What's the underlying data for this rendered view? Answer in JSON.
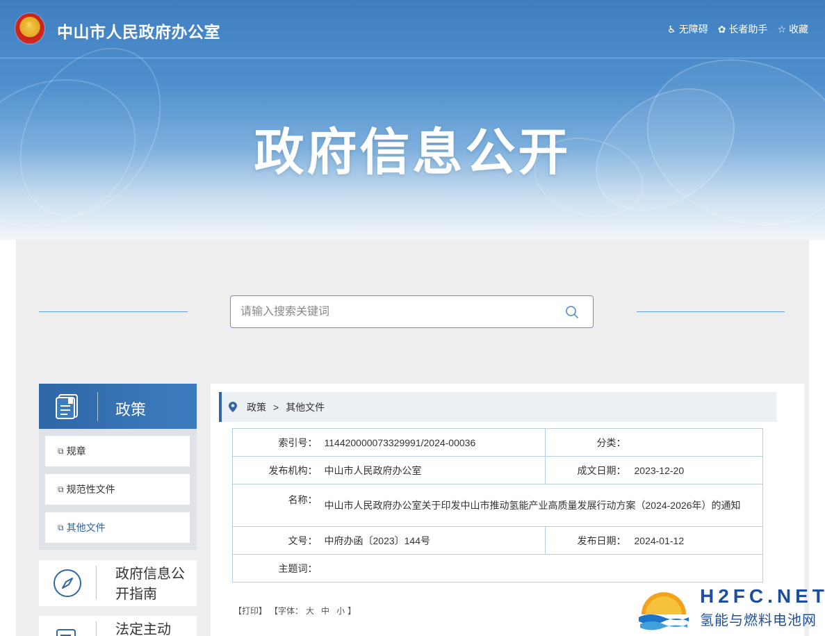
{
  "header": {
    "site_title": "中山市人民政府办公室",
    "links": [
      {
        "label": "无障碍",
        "icon": "wheelchair-icon"
      },
      {
        "label": "长者助手",
        "icon": "elderly-icon"
      },
      {
        "label": "收藏",
        "icon": "star-icon"
      }
    ]
  },
  "hero": {
    "title": "政府信息公开"
  },
  "search": {
    "placeholder": "请输入搜索关键词"
  },
  "sidebar": {
    "title": "政策",
    "items": [
      {
        "label": "规章"
      },
      {
        "label": "规范性文件"
      },
      {
        "label": "其他文件"
      }
    ],
    "cards": [
      {
        "label": "政府信息公开指南"
      },
      {
        "label": "法定主动"
      }
    ]
  },
  "breadcrumb": {
    "items": [
      "政策",
      "其他文件"
    ]
  },
  "meta": {
    "index_label": "索引号：",
    "index_value": "114420000073329991/2024-00036",
    "category_label": "分类：",
    "category_value": "",
    "publisher_label": "发布机构：",
    "publisher_value": "中山市人民政府办公室",
    "created_label": "成文日期：",
    "created_value": "2023-12-20",
    "name_label": "名称：",
    "name_value": "中山市人民政府办公室关于印发中山市推动氢能产业高质量发展行动方案（2024-2026年）的通知",
    "docno_label": "文号：",
    "docno_value": "中府办函〔2023〕144号",
    "published_label": "发布日期：",
    "published_value": "2024-01-12",
    "keywords_label": "主题词：",
    "keywords_value": ""
  },
  "tools": {
    "print": "【打印】",
    "font_prefix": "【字体：",
    "font_large": "大",
    "font_medium": "中",
    "font_small": "小",
    "font_suffix": "】"
  },
  "watermark": {
    "en": "H2FC.NET",
    "cn": "氢能与燃料电池网"
  },
  "colors": {
    "brand": "#2f66a6",
    "border": "#b7cde0",
    "panel": "#eeeeee"
  }
}
